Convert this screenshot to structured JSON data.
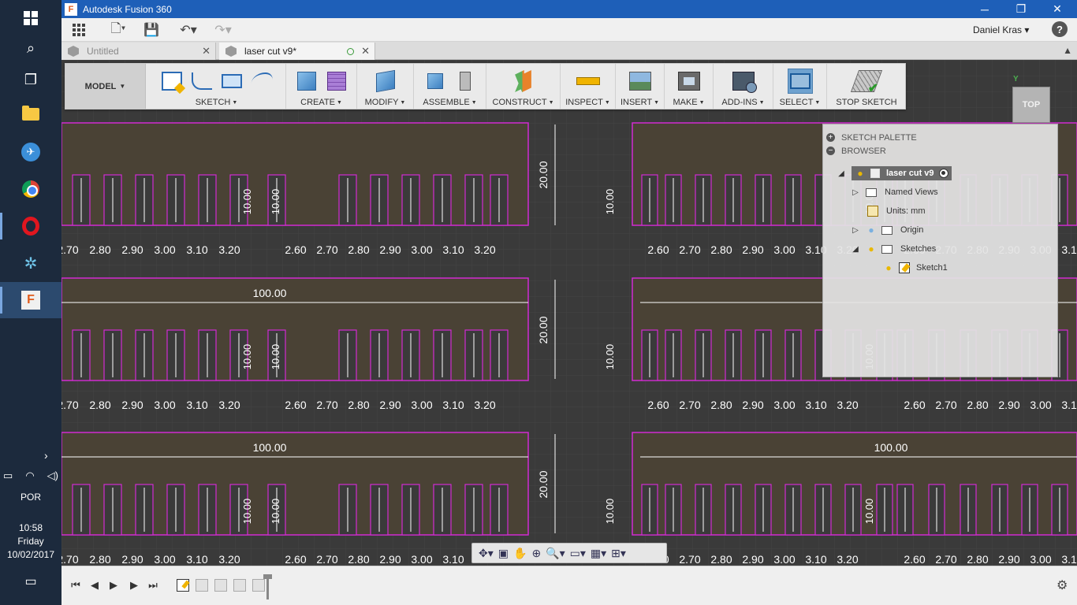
{
  "window": {
    "title": "Autodesk Fusion 360"
  },
  "appbar": {
    "user": "Daniel Kras",
    "help": "?"
  },
  "tabs": [
    {
      "label": "Untitled"
    },
    {
      "label": "laser cut v9*"
    }
  ],
  "toolbar": {
    "workspace": "MODEL",
    "groups": {
      "sketch": "SKETCH",
      "create": "CREATE",
      "modify": "MODIFY",
      "assemble": "ASSEMBLE",
      "construct": "CONSTRUCT",
      "inspect": "INSPECT",
      "insert": "INSERT",
      "make": "MAKE",
      "addins": "ADD-INS",
      "select": "SELECT",
      "stop_sketch": "STOP SKETCH"
    }
  },
  "viewcube": {
    "face": "TOP",
    "axis": "Y"
  },
  "panels": {
    "sketch_palette": "SKETCH PALETTE",
    "browser": "BROWSER"
  },
  "browser_tree": {
    "component": "laser cut v9",
    "named_views": "Named Views",
    "units": "Units: mm",
    "origin": "Origin",
    "sketches": "Sketches",
    "sketch1": "Sketch1"
  },
  "drawing": {
    "dim_100": "100.00",
    "dim_20": "20.00",
    "dim_10": "10.00",
    "dim_10_small": "10.00",
    "row_series_a": [
      "2.70",
      "2.80",
      "2.90",
      "3.00",
      "3.10",
      "3.20"
    ],
    "row_series_b": [
      "2.60",
      "2.70",
      "2.80",
      "2.90",
      "3.00",
      "3.10",
      "3.20"
    ]
  },
  "system_tray": {
    "language": "POR",
    "time": "10:58",
    "day": "Friday",
    "date": "10/02/2017"
  },
  "colors": {
    "titlebar": "#1e5fb8",
    "sketch_region": "#4a4235",
    "sketch_line": "#d22bd2",
    "dimension": "#ffffff"
  }
}
